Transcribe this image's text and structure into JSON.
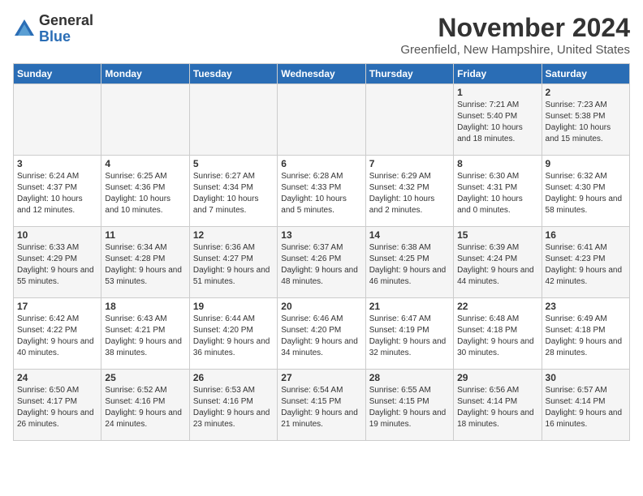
{
  "logo": {
    "general": "General",
    "blue": "Blue"
  },
  "title": "November 2024",
  "location": "Greenfield, New Hampshire, United States",
  "days_of_week": [
    "Sunday",
    "Monday",
    "Tuesday",
    "Wednesday",
    "Thursday",
    "Friday",
    "Saturday"
  ],
  "weeks": [
    [
      {
        "day": "",
        "info": ""
      },
      {
        "day": "",
        "info": ""
      },
      {
        "day": "",
        "info": ""
      },
      {
        "day": "",
        "info": ""
      },
      {
        "day": "",
        "info": ""
      },
      {
        "day": "1",
        "info": "Sunrise: 7:21 AM\nSunset: 5:40 PM\nDaylight: 10 hours and 18 minutes."
      },
      {
        "day": "2",
        "info": "Sunrise: 7:23 AM\nSunset: 5:38 PM\nDaylight: 10 hours and 15 minutes."
      }
    ],
    [
      {
        "day": "3",
        "info": "Sunrise: 6:24 AM\nSunset: 4:37 PM\nDaylight: 10 hours and 12 minutes."
      },
      {
        "day": "4",
        "info": "Sunrise: 6:25 AM\nSunset: 4:36 PM\nDaylight: 10 hours and 10 minutes."
      },
      {
        "day": "5",
        "info": "Sunrise: 6:27 AM\nSunset: 4:34 PM\nDaylight: 10 hours and 7 minutes."
      },
      {
        "day": "6",
        "info": "Sunrise: 6:28 AM\nSunset: 4:33 PM\nDaylight: 10 hours and 5 minutes."
      },
      {
        "day": "7",
        "info": "Sunrise: 6:29 AM\nSunset: 4:32 PM\nDaylight: 10 hours and 2 minutes."
      },
      {
        "day": "8",
        "info": "Sunrise: 6:30 AM\nSunset: 4:31 PM\nDaylight: 10 hours and 0 minutes."
      },
      {
        "day": "9",
        "info": "Sunrise: 6:32 AM\nSunset: 4:30 PM\nDaylight: 9 hours and 58 minutes."
      }
    ],
    [
      {
        "day": "10",
        "info": "Sunrise: 6:33 AM\nSunset: 4:29 PM\nDaylight: 9 hours and 55 minutes."
      },
      {
        "day": "11",
        "info": "Sunrise: 6:34 AM\nSunset: 4:28 PM\nDaylight: 9 hours and 53 minutes."
      },
      {
        "day": "12",
        "info": "Sunrise: 6:36 AM\nSunset: 4:27 PM\nDaylight: 9 hours and 51 minutes."
      },
      {
        "day": "13",
        "info": "Sunrise: 6:37 AM\nSunset: 4:26 PM\nDaylight: 9 hours and 48 minutes."
      },
      {
        "day": "14",
        "info": "Sunrise: 6:38 AM\nSunset: 4:25 PM\nDaylight: 9 hours and 46 minutes."
      },
      {
        "day": "15",
        "info": "Sunrise: 6:39 AM\nSunset: 4:24 PM\nDaylight: 9 hours and 44 minutes."
      },
      {
        "day": "16",
        "info": "Sunrise: 6:41 AM\nSunset: 4:23 PM\nDaylight: 9 hours and 42 minutes."
      }
    ],
    [
      {
        "day": "17",
        "info": "Sunrise: 6:42 AM\nSunset: 4:22 PM\nDaylight: 9 hours and 40 minutes."
      },
      {
        "day": "18",
        "info": "Sunrise: 6:43 AM\nSunset: 4:21 PM\nDaylight: 9 hours and 38 minutes."
      },
      {
        "day": "19",
        "info": "Sunrise: 6:44 AM\nSunset: 4:20 PM\nDaylight: 9 hours and 36 minutes."
      },
      {
        "day": "20",
        "info": "Sunrise: 6:46 AM\nSunset: 4:20 PM\nDaylight: 9 hours and 34 minutes."
      },
      {
        "day": "21",
        "info": "Sunrise: 6:47 AM\nSunset: 4:19 PM\nDaylight: 9 hours and 32 minutes."
      },
      {
        "day": "22",
        "info": "Sunrise: 6:48 AM\nSunset: 4:18 PM\nDaylight: 9 hours and 30 minutes."
      },
      {
        "day": "23",
        "info": "Sunrise: 6:49 AM\nSunset: 4:18 PM\nDaylight: 9 hours and 28 minutes."
      }
    ],
    [
      {
        "day": "24",
        "info": "Sunrise: 6:50 AM\nSunset: 4:17 PM\nDaylight: 9 hours and 26 minutes."
      },
      {
        "day": "25",
        "info": "Sunrise: 6:52 AM\nSunset: 4:16 PM\nDaylight: 9 hours and 24 minutes."
      },
      {
        "day": "26",
        "info": "Sunrise: 6:53 AM\nSunset: 4:16 PM\nDaylight: 9 hours and 23 minutes."
      },
      {
        "day": "27",
        "info": "Sunrise: 6:54 AM\nSunset: 4:15 PM\nDaylight: 9 hours and 21 minutes."
      },
      {
        "day": "28",
        "info": "Sunrise: 6:55 AM\nSunset: 4:15 PM\nDaylight: 9 hours and 19 minutes."
      },
      {
        "day": "29",
        "info": "Sunrise: 6:56 AM\nSunset: 4:14 PM\nDaylight: 9 hours and 18 minutes."
      },
      {
        "day": "30",
        "info": "Sunrise: 6:57 AM\nSunset: 4:14 PM\nDaylight: 9 hours and 16 minutes."
      }
    ]
  ]
}
